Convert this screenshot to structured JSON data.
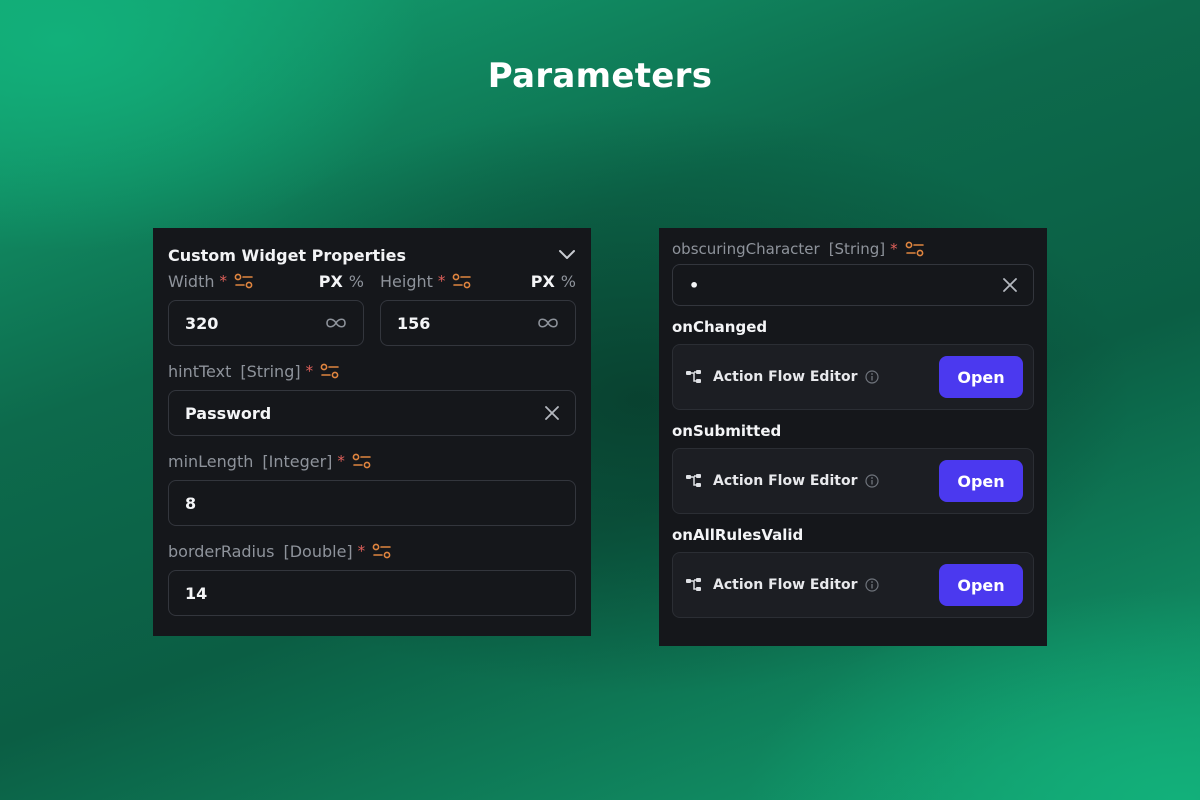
{
  "page": {
    "title": "Parameters"
  },
  "left_panel": {
    "title": "Custom Widget Properties",
    "width": {
      "label": "Width",
      "required": "*",
      "value": "320",
      "unit_px": "PX",
      "unit_pct": "%"
    },
    "height": {
      "label": "Height",
      "required": "*",
      "value": "156",
      "unit_px": "PX",
      "unit_pct": "%"
    },
    "hint_text": {
      "label": "hintText",
      "type": "[String]",
      "required": "*",
      "value": "Password"
    },
    "min_length": {
      "label": "minLength",
      "type": "[Integer]",
      "required": "*",
      "value": "8"
    },
    "border_radius": {
      "label": "borderRadius",
      "type": "[Double]",
      "required": "*",
      "value": "14"
    }
  },
  "right_panel": {
    "obscuring": {
      "label": "obscuringCharacter",
      "type": "[String]",
      "required": "*",
      "value": "•"
    },
    "actions": [
      {
        "label": "onChanged",
        "editor": "Action Flow Editor",
        "button": "Open"
      },
      {
        "label": "onSubmitted",
        "editor": "Action Flow Editor",
        "button": "Open"
      },
      {
        "label": "onAllRulesValid",
        "editor": "Action Flow Editor",
        "button": "Open"
      }
    ]
  },
  "icons": {
    "variable": "variable-settings-icon",
    "clear": "close-icon",
    "infinity": "infinity-icon",
    "chevron": "chevron-down-icon",
    "flow": "action-flow-icon",
    "info": "info-icon"
  },
  "colors": {
    "accent": "#4b39ef",
    "panel_bg": "#15171b",
    "required": "#e0605a",
    "variable_icon": "#e0853f"
  }
}
